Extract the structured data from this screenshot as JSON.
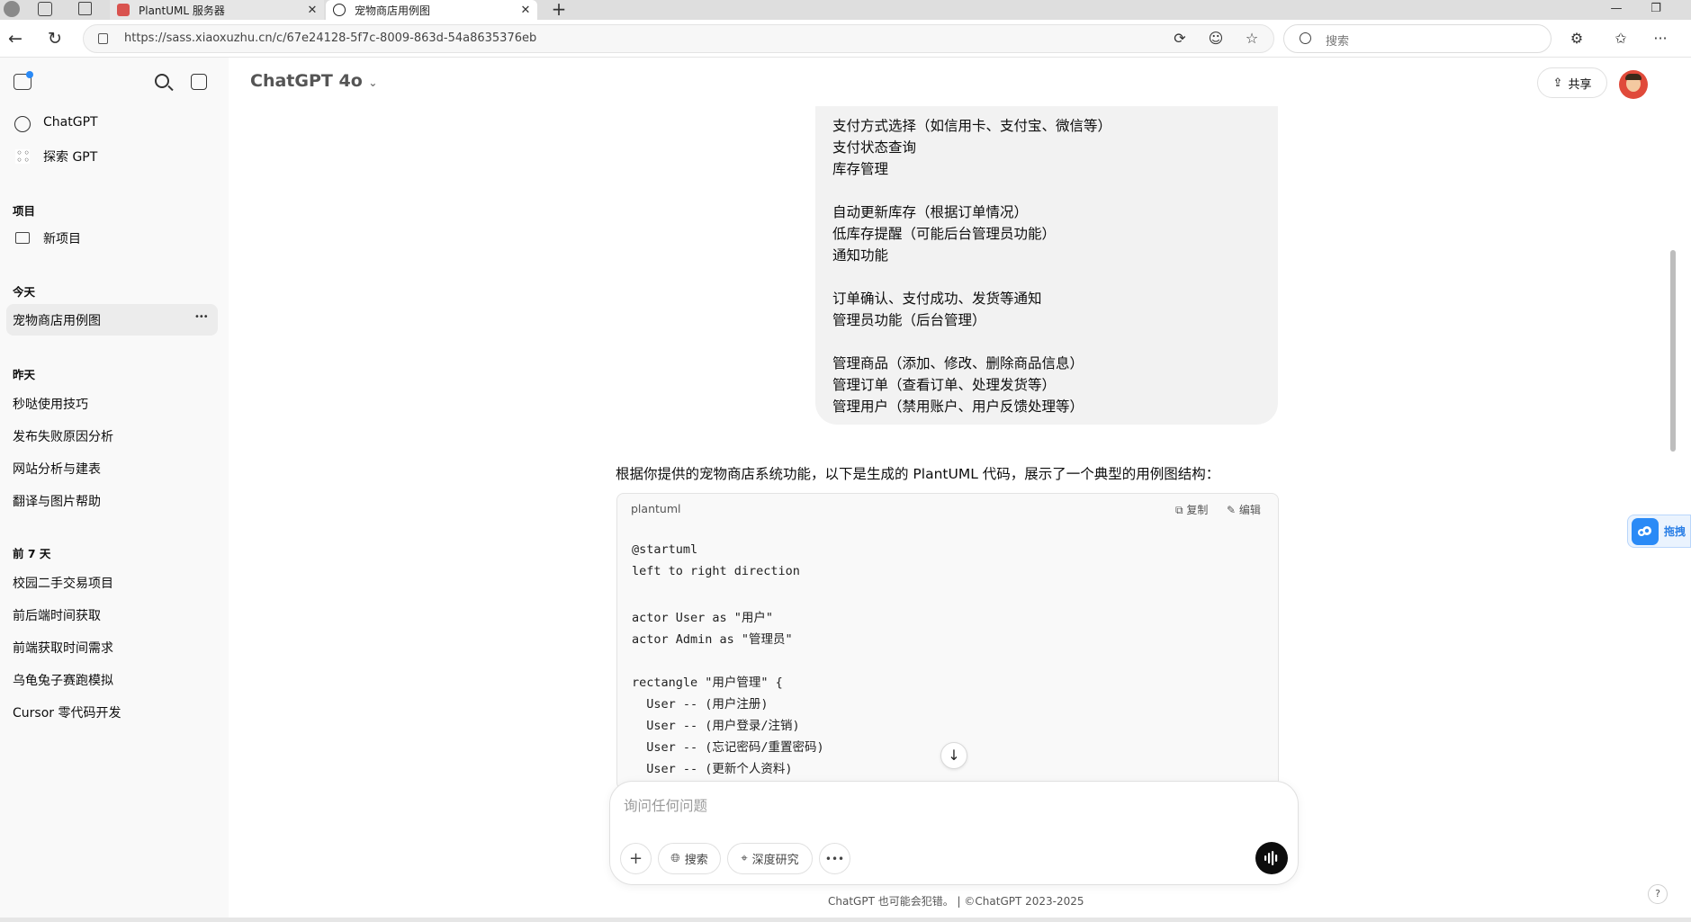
{
  "browser": {
    "tabs": [
      {
        "title": "PlantUML 服务器",
        "active": false
      },
      {
        "title": "宠物商店用例图",
        "active": true
      }
    ],
    "url": "https://sass.xiaoxuzhu.cn/c/67e24128-5f7c-8009-863d-54a8635376eb",
    "search_placeholder": "搜索"
  },
  "sidebar": {
    "top_items": [
      {
        "label": "ChatGPT",
        "icon": "openai-logo-icon"
      },
      {
        "label": "探索 GPT",
        "icon": "grid-icon"
      }
    ],
    "projects_heading": "项目",
    "new_project": "新项目",
    "sections": [
      {
        "heading": "今天",
        "items": [
          "宠物商店用例图"
        ]
      },
      {
        "heading": "昨天",
        "items": [
          "秒哒使用技巧",
          "发布失败原因分析",
          "网站分析与建表",
          "翻译与图片帮助"
        ]
      },
      {
        "heading": "前 7 天",
        "items": [
          "校园二手交易项目",
          "前后端时间获取",
          "前端获取时间需求",
          "乌龟兔子赛跑模拟",
          "Cursor 零代码开发"
        ]
      }
    ],
    "more_glyph": "•••"
  },
  "header": {
    "model_name": "ChatGPT 4o",
    "share_label": "共享"
  },
  "user_message_lines": [
    "支付方式选择（如信用卡、支付宝、微信等）",
    "支付状态查询",
    "库存管理",
    "",
    "自动更新库存（根据订单情况）",
    "低库存提醒（可能后台管理员功能）",
    "通知功能",
    "",
    "订单确认、支付成功、发货等通知",
    "管理员功能（后台管理）",
    "",
    "管理商品（添加、修改、删除商品信息）",
    "管理订单（查看订单、处理发货等）",
    "管理用户（禁用账户、用户反馈处理等）"
  ],
  "assistant": {
    "intro": "根据你提供的宠物商店系统功能，以下是生成的 PlantUML 代码，展示了一个典型的用例图结构：",
    "code_language": "plantuml",
    "copy_label": "复制",
    "edit_label": "编辑",
    "code_lines": [
      "@startuml",
      "left to right direction",
      "",
      "actor User as \"用户\"",
      "actor Admin as \"管理员\"",
      "",
      "rectangle \"用户管理\" {",
      "  User -- (用户注册)",
      "  User -- (用户登录/注销)",
      "  User -- (忘记密码/重置密码)",
      "  User -- (更新个人资料)"
    ]
  },
  "composer": {
    "placeholder": "询问任何问题",
    "search_label": "搜索",
    "deep_research_label": "深度研究"
  },
  "footer": {
    "disclaimer": "ChatGPT 也可能会犯错。 | ©ChatGPT 2023-2025",
    "help": "?"
  },
  "side_widget": {
    "label": "拖拽"
  },
  "colors": {
    "accent_widget": "#2a8af6",
    "user_bubble": "#f2f2f2",
    "sidebar_bg": "#f9f9f9"
  }
}
